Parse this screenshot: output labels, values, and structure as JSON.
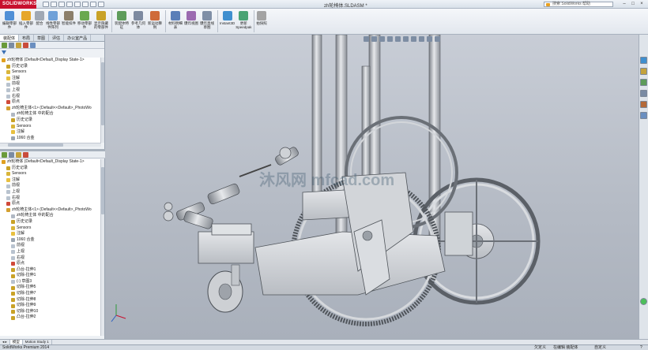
{
  "app": {
    "logo_text": "SOLIDWORKS",
    "document_title": "zh轮椅体.SLDASM *",
    "help_search": "搜索 SolidWorks 帮助",
    "minimize": "–",
    "restore": "□",
    "close": "×"
  },
  "ribbon": {
    "buttons": [
      {
        "label": "编辑零部件",
        "color": "#4f8fd6"
      },
      {
        "label": "插入零部件",
        "color": "#e6a62a"
      },
      {
        "label": "配合",
        "color": "#a0a8b4"
      },
      {
        "label": "线性零部件阵列",
        "color": "#6fa0d8"
      },
      {
        "label": "智能扣件",
        "color": "#8c7f6a"
      },
      {
        "label": "移动零部件",
        "color": "#6aa84f"
      },
      {
        "label": "显示隐藏的零部件",
        "color": "#c9a227"
      },
      {
        "label": "装配体特征",
        "color": "#5e9c5a"
      },
      {
        "label": "参考几何体",
        "color": "#7d8aa0"
      },
      {
        "label": "新运动算例",
        "color": "#cf6b3a"
      },
      {
        "label": "材料明细表",
        "color": "#5a7fb8"
      },
      {
        "label": "爆炸视图",
        "color": "#9b6ab0"
      },
      {
        "label": "爆炸直线草图",
        "color": "#7f8fa6"
      },
      {
        "label": "Instant3D",
        "color": "#3f8fcf"
      },
      {
        "label": "更新 Speedpak",
        "color": "#4aa374"
      },
      {
        "label": "拍快照",
        "color": "#a3a3a3"
      }
    ]
  },
  "left_panel": {
    "tabs": [
      "装配体",
      "布局",
      "草图",
      "评估",
      "办公室产品"
    ],
    "filter_icon": "filter-icon",
    "tree_top": [
      {
        "text": "zh轮椅体 (Default<Default_Display State-1>",
        "icon": "#e0a020",
        "indent": 0
      },
      {
        "text": "历史记录",
        "icon": "#c9a227",
        "indent": 1
      },
      {
        "text": "Sensors",
        "icon": "#d9b53a",
        "indent": 1
      },
      {
        "text": "注解",
        "icon": "#e8c040",
        "indent": 1
      },
      {
        "text": "前视",
        "icon": "#b9c3cf",
        "indent": 1
      },
      {
        "text": "上视",
        "icon": "#b9c3cf",
        "indent": 1
      },
      {
        "text": "右视",
        "icon": "#b9c3cf",
        "indent": 1
      },
      {
        "text": "原点",
        "icon": "#d04a3a",
        "indent": 1
      },
      {
        "text": "zh轮椅主体<1> (Default<<Default>_PhotoWo",
        "icon": "#d4a030",
        "indent": 1
      },
      {
        "text": "zh轮椅主体 中的配合",
        "icon": "#b0b8c3",
        "indent": 2
      },
      {
        "text": "历史记录",
        "icon": "#c9a227",
        "indent": 2
      },
      {
        "text": "Sensors",
        "icon": "#d9b53a",
        "indent": 2
      },
      {
        "text": "注解",
        "icon": "#e8c040",
        "indent": 2
      },
      {
        "text": "1060 合金",
        "icon": "#9aa4b0",
        "indent": 2
      }
    ],
    "tree_bottom": [
      {
        "text": "zh轮椅体 (Default<Default_Display State-1>",
        "icon": "#e0a020",
        "indent": 0
      },
      {
        "text": "历史记录",
        "icon": "#c9a227",
        "indent": 1
      },
      {
        "text": "Sensors",
        "icon": "#d9b53a",
        "indent": 1
      },
      {
        "text": "注解",
        "icon": "#e8c040",
        "indent": 1
      },
      {
        "text": "前视",
        "icon": "#b9c3cf",
        "indent": 1
      },
      {
        "text": "上视",
        "icon": "#b9c3cf",
        "indent": 1
      },
      {
        "text": "右视",
        "icon": "#b9c3cf",
        "indent": 1
      },
      {
        "text": "原点",
        "icon": "#d04a3a",
        "indent": 1
      },
      {
        "text": "zh轮椅主体<1> (Default<<Default>_PhotoWo",
        "icon": "#d4a030",
        "indent": 1
      },
      {
        "text": "zh轮椅主体 中的配合",
        "icon": "#b0b8c3",
        "indent": 2
      },
      {
        "text": "历史记录",
        "icon": "#c9a227",
        "indent": 2
      },
      {
        "text": "Sensors",
        "icon": "#d9b53a",
        "indent": 2
      },
      {
        "text": "注解",
        "icon": "#e8c040",
        "indent": 2
      },
      {
        "text": "1060 合金",
        "icon": "#9aa4b0",
        "indent": 2
      },
      {
        "text": "前视",
        "icon": "#b9c3cf",
        "indent": 2
      },
      {
        "text": "上视",
        "icon": "#b9c3cf",
        "indent": 2
      },
      {
        "text": "右视",
        "icon": "#b9c3cf",
        "indent": 2
      },
      {
        "text": "原点",
        "icon": "#d04a3a",
        "indent": 2
      },
      {
        "text": "凸台-拉伸1",
        "icon": "#c9a227",
        "indent": 2
      },
      {
        "text": "切除-拉伸1",
        "icon": "#c9a227",
        "indent": 2
      },
      {
        "text": "(-) 草图3",
        "icon": "#b9c3cf",
        "indent": 2
      },
      {
        "text": "切除-拉伸5",
        "icon": "#c9a227",
        "indent": 2
      },
      {
        "text": "切除-拉伸7",
        "icon": "#c9a227",
        "indent": 2
      },
      {
        "text": "切除-拉伸8",
        "icon": "#c9a227",
        "indent": 2
      },
      {
        "text": "切除-拉伸9",
        "icon": "#c9a227",
        "indent": 2
      },
      {
        "text": "切除-拉伸10",
        "icon": "#c9a227",
        "indent": 2
      },
      {
        "text": "凸台-拉伸2",
        "icon": "#c9a227",
        "indent": 2
      }
    ]
  },
  "viewport": {
    "watermark": "沐风网 mfcad.com"
  },
  "bottom_tabs": [
    "模型",
    "Motion Study 1"
  ],
  "status": {
    "product": "SolidWorks Premium 2014",
    "state": "欠定义",
    "mode": "在编辑 装配体",
    "units": "自定义",
    "help": "?"
  },
  "colors": {
    "metal": "#c9ccd0",
    "metal_dark": "#8e939a",
    "accent_red": "#c8102e"
  }
}
